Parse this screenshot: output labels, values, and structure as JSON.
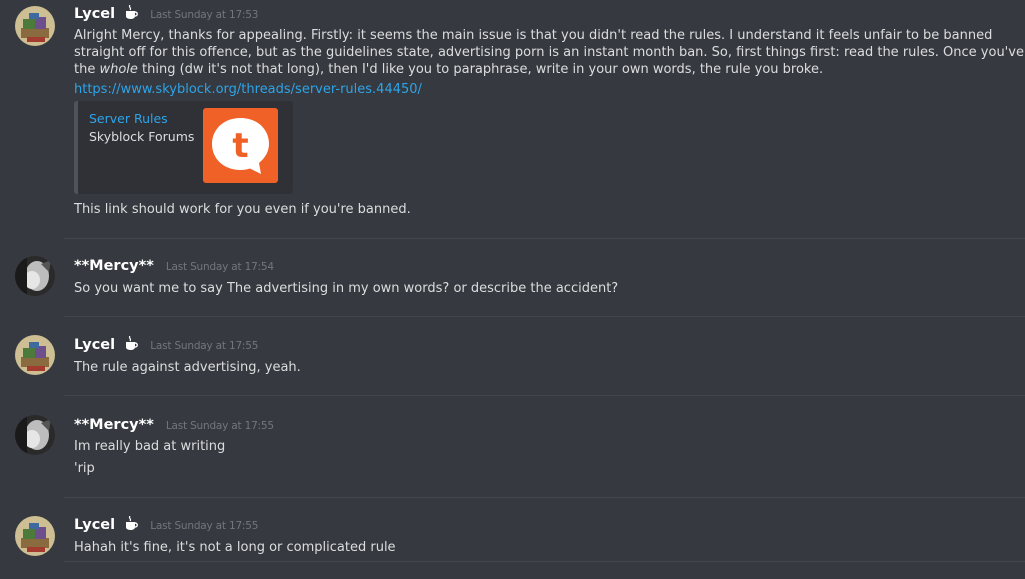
{
  "messages": [
    {
      "author": "Lycel",
      "timestamp": "Last Sunday at 17:53",
      "lines": [
        "Alright Mercy, thanks for appealing. Firstly: it seems the main issue is that you didn't read the rules. I understand it feels unfair to be banned",
        "straight off for this offence, but as the guidelines state, advertising porn is an instant month ban. So, first things first: read the rules. Once you've read"
      ],
      "line3_before": "the ",
      "line3_italic": "whole",
      "line3_after": " thing (dw it's not that long), then I'd like you to paraphrase, write in your own words, the rule you broke.",
      "link": "https://www.skyblock.org/threads/server-rules.44450/",
      "embed": {
        "title": "Server Rules",
        "provider": "Skyblock Forums",
        "thumb_icon": "t",
        "thumb_color": "#f06127"
      },
      "after_embed": "This link should work for you even if you're banned."
    },
    {
      "author": "**Mercy**",
      "timestamp": "Last Sunday at 17:54",
      "lines": [
        "So you want me to say The advertising in my own words? or describe the accident?"
      ]
    },
    {
      "author": "Lycel",
      "timestamp": "Last Sunday at 17:55",
      "lines": [
        "The rule against advertising, yeah."
      ]
    },
    {
      "author": "**Mercy**",
      "timestamp": "Last Sunday at 17:55",
      "lines": [
        "Im really bad at writing",
        "'rip"
      ]
    },
    {
      "author": "Lycel",
      "timestamp": "Last Sunday at 17:55",
      "lines": [
        "Hahah it's fine, it's not a long or complicated rule"
      ]
    }
  ],
  "colors": {
    "background": "#36393f",
    "link": "#2ea4e8",
    "username": "#ffffff",
    "timestamp": "#72767d",
    "text": "#dcddde"
  },
  "icons": {
    "lycel_badge": "coffee-cup-icon"
  }
}
